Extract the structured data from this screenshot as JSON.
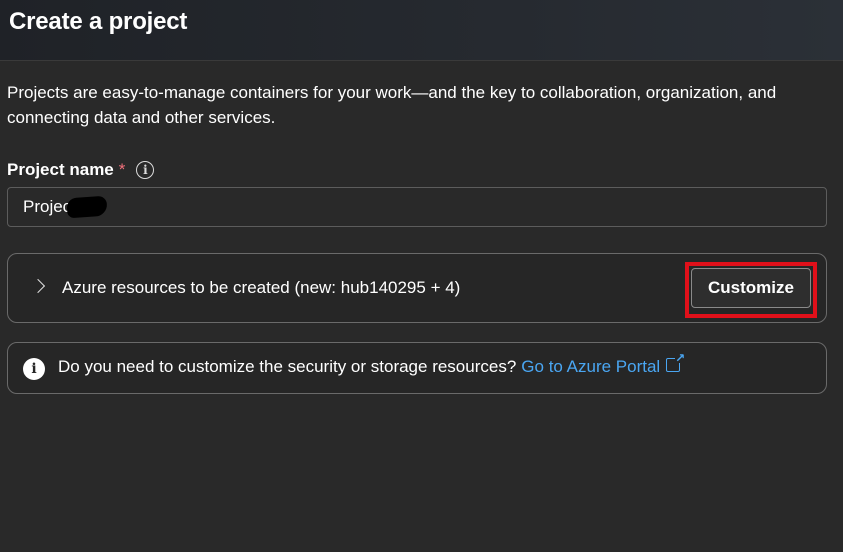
{
  "header": {
    "title": "Create a project"
  },
  "description": "Projects are easy-to-manage containers for your work—and the key to collaboration, organization, and connecting data and other services.",
  "project_name": {
    "label": "Project name",
    "required_marker": "*",
    "info_icon": "info-icon",
    "value": "Projec"
  },
  "resources": {
    "expand_icon": "chevron-right-icon",
    "label": "Azure resources to be created (new: hub140295 + 4)",
    "customize_label": "Customize"
  },
  "info_bar": {
    "icon": "info-filled-icon",
    "text": "Do you need to customize the security or storage resources?",
    "link_label": "Go to Azure Portal",
    "link_icon": "external-link-icon"
  },
  "colors": {
    "background": "#292929",
    "link": "#4aa6f2",
    "required": "#f1707b",
    "highlight": "#e0101a"
  }
}
